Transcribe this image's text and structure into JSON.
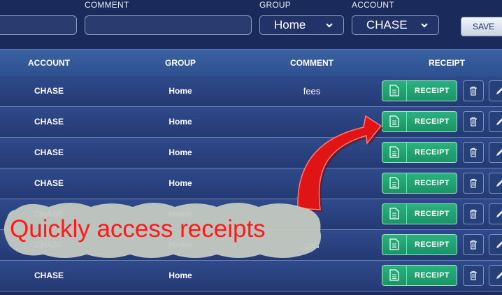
{
  "filters": {
    "comment_label": "COMMENT",
    "group_label": "GROUP",
    "group_value": "Home",
    "account_label": "ACCOUNT",
    "account_value": "CHASE",
    "save_label": "SAVE"
  },
  "table": {
    "headers": {
      "account": "ACCOUNT",
      "group": "GROUP",
      "comment": "COMMENT",
      "receipt": "RECEIPT"
    },
    "receipt_label": "RECEIPT",
    "rows": [
      {
        "account": "CHASE",
        "group": "Home",
        "comment": "fees"
      },
      {
        "account": "CHASE",
        "group": "Home",
        "comment": ""
      },
      {
        "account": "CHASE",
        "group": "Home",
        "comment": ""
      },
      {
        "account": "CHASE",
        "group": "Home",
        "comment": ""
      },
      {
        "account": "CHASE",
        "group": "Home",
        "comment": ""
      },
      {
        "account": "CHASE",
        "group": "Home",
        "comment": "gas"
      },
      {
        "account": "CHASE",
        "group": "Home",
        "comment": ""
      }
    ]
  },
  "annotation": {
    "callout_text": "Quickly access receipts"
  },
  "colors": {
    "receipt_green": "#22a574",
    "header_blue": "#3a62a2",
    "callout_red": "#ff1a1a"
  },
  "icons": [
    "chevron-down-icon",
    "document-icon",
    "trash-icon",
    "pencil-icon",
    "arrow-icon"
  ]
}
